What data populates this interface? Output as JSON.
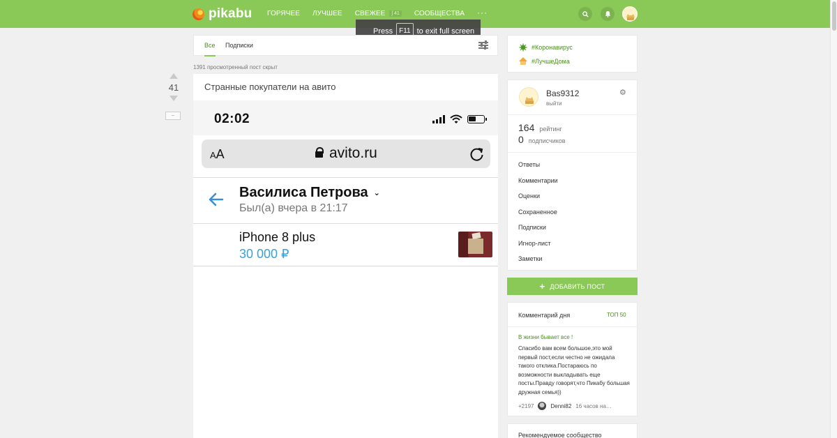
{
  "header": {
    "logo_text": "pikabu",
    "nav": [
      "ГОРЯЧЕЕ",
      "ЛУЧШЕЕ",
      "СВЕЖЕЕ",
      "СООБЩЕСТВА"
    ],
    "fresh_badge": "41",
    "more_label": "···",
    "search_icon": "search-icon",
    "bell_icon": "bell-icon"
  },
  "fullscreen_toast": {
    "before": "Press",
    "key": "F11",
    "after": "to exit full screen"
  },
  "feed": {
    "tabs": [
      "Все",
      "Подписки"
    ],
    "active_tab": "Все",
    "hidden_note": "1391 просмотренный пост скрыт"
  },
  "post": {
    "rating": "41",
    "collapse_label": "–",
    "title": "Странные покупатели на авито",
    "screenshot": {
      "time": "02:02",
      "aa_label": "AA",
      "url": "avito.ru",
      "contact_name": "Василиса Петрова",
      "contact_status": "Был(а) вчера в 21:17",
      "item_title": "iPhone 8 plus",
      "item_price": "30 000 ₽"
    }
  },
  "sidebar": {
    "tags": [
      "#Коронавирус",
      "#ЛучшеДома"
    ],
    "user": {
      "name": "Bas9312",
      "logout": "выйти",
      "rating_value": "164",
      "rating_label": "рейтинг",
      "subs_value": "0",
      "subs_label": "подписчиков"
    },
    "menu": [
      "Ответы",
      "Комментарии",
      "Оценки",
      "Сохраненное",
      "Подписки",
      "Игнор-лист",
      "Заметки"
    ],
    "add_post": "ДОБАВИТЬ ПОСТ",
    "comment_of_day": {
      "title": "Комментарий дня",
      "top_link": "ТОП 50",
      "post_title": "В жизни бывает все !",
      "text": "Спасибо вам всем большое,это мой первый пост,если честно не ожидала такого отклика.Постараюсь по возможности выкладывать еще посты.Правду говорят,что Пикабу большая дружная семья))",
      "rating": "+2197",
      "author": "Denni82",
      "time": "16 часов на…"
    },
    "recommended_title": "Рекомендуемое сообщество"
  },
  "colors": {
    "brand_green": "#8ac858",
    "link_green": "#4a8f21",
    "price_blue": "#3a9fdb"
  }
}
